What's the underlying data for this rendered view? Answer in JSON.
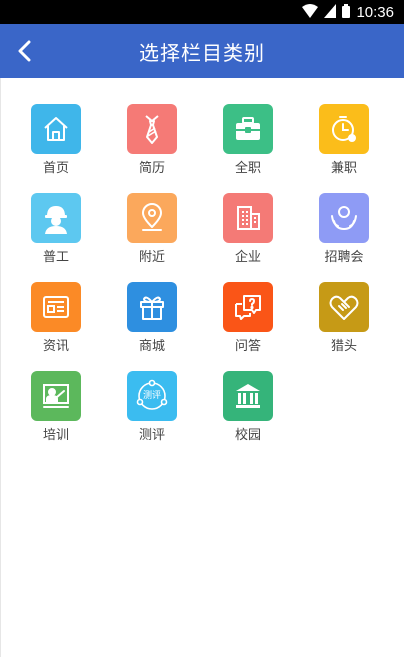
{
  "status_bar": {
    "time": "10:36"
  },
  "app_bar": {
    "title": "选择栏目类别"
  },
  "categories": [
    {
      "label": "首页",
      "icon": "home-icon",
      "color": "#3fb6ea"
    },
    {
      "label": "简历",
      "icon": "tie-icon",
      "color": "#f57a76"
    },
    {
      "label": "全职",
      "icon": "briefcase-icon",
      "color": "#3cbf86"
    },
    {
      "label": "兼职",
      "icon": "clock-icon",
      "color": "#fbbd1a"
    },
    {
      "label": "普工",
      "icon": "worker-icon",
      "color": "#5dc8f0"
    },
    {
      "label": "附近",
      "icon": "location-pin-icon",
      "color": "#fba85c"
    },
    {
      "label": "企业",
      "icon": "building-icon",
      "color": "#f47a76"
    },
    {
      "label": "招聘会",
      "icon": "meeting-icon",
      "color": "#8e9bf5"
    },
    {
      "label": "资讯",
      "icon": "news-icon",
      "color": "#fb8a26"
    },
    {
      "label": "商城",
      "icon": "gift-icon",
      "color": "#2e8fe0"
    },
    {
      "label": "问答",
      "icon": "question-chat-icon",
      "color": "#fa5517"
    },
    {
      "label": "猎头",
      "icon": "handshake-heart-icon",
      "color": "#c69a16"
    },
    {
      "label": "培训",
      "icon": "training-board-icon",
      "color": "#5cb85c"
    },
    {
      "label": "测评",
      "icon": "assessment-icon",
      "color": "#3bbcf0",
      "icon_text": "测评"
    },
    {
      "label": "校园",
      "icon": "campus-icon",
      "color": "#35b47a"
    }
  ]
}
